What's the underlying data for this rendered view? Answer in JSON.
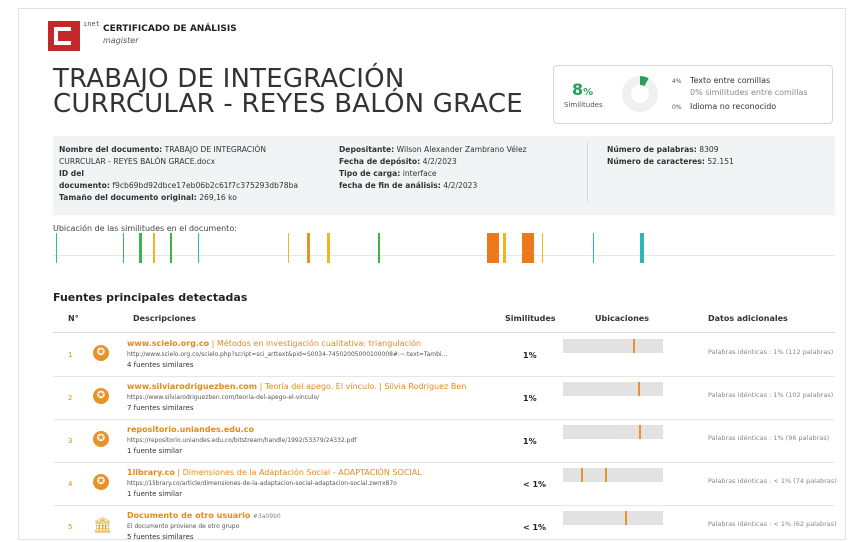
{
  "header": {
    "logo_side_text": "ınet",
    "certificate_title": "CERTIFICADO DE ANÁLISIS",
    "certificate_subtitle": "magister"
  },
  "document_title_line1": "TRABAJO DE INTEGRACIÓN",
  "document_title_line2": "CURRCULAR - REYES BALÓN GRACE",
  "similarity": {
    "percent": "8",
    "percent_sign": "%",
    "label": "Similitudes",
    "lines": [
      {
        "pct": "4%",
        "text": "Texto entre comillas",
        "muted": false
      },
      {
        "pct": "",
        "text": "0% similitudes entre comillas",
        "muted": true
      },
      {
        "pct": "0%",
        "text": "Idioma no reconocido",
        "muted": false
      }
    ]
  },
  "meta": {
    "col1": {
      "name_label": "Nombre del documento:",
      "name_value": "TRABAJO DE INTEGRACIÓN",
      "name_value2": "CURRCULAR - REYES BALÓN GRACE.docx",
      "id_label": "ID del",
      "id_label2": "documento:",
      "id_value": "f9cb69bd92dbce17eb06b2c61f7c375293db78ba",
      "size_label": "Tamaño del documento original:",
      "size_value": "269,16 ko"
    },
    "col2": {
      "depositor_label": "Depositante:",
      "depositor_value": "Wilson Alexander Zambrano Vélez",
      "deposit_date_label": "Fecha de depósito:",
      "deposit_date_value": "4/2/2023",
      "load_type_label": "Tipo de carga:",
      "load_type_value": "interface",
      "end_date_label": "fecha de fin de análisis:",
      "end_date_value": "4/2/2023"
    },
    "col3": {
      "words_label": "Número de palabras:",
      "words_value": "8309",
      "chars_label": "Número de caracteres:",
      "chars_value": "52.151"
    }
  },
  "location_label": "Ubicación de las similitudes en el documento:",
  "location_marks": [
    {
      "pos": 0.004,
      "color": "#2bb7b3",
      "width": 1
    },
    {
      "pos": 0.09,
      "color": "#3ab54a",
      "width": 1
    },
    {
      "pos": 0.11,
      "color": "#3ab54a",
      "width": 3
    },
    {
      "pos": 0.128,
      "color": "#f2b51e",
      "width": 2
    },
    {
      "pos": 0.15,
      "color": "#3ab54a",
      "width": 2
    },
    {
      "pos": 0.185,
      "color": "#2bb7b3",
      "width": 1
    },
    {
      "pos": 0.3,
      "color": "#f2b51e",
      "width": 1
    },
    {
      "pos": 0.325,
      "color": "#e8922a",
      "width": 3
    },
    {
      "pos": 0.35,
      "color": "#f2b51e",
      "width": 3
    },
    {
      "pos": 0.415,
      "color": "#3ab54a",
      "width": 2
    },
    {
      "pos": 0.555,
      "color": "#ec7a1c",
      "width": 12
    },
    {
      "pos": 0.575,
      "color": "#f2b51e",
      "width": 3
    },
    {
      "pos": 0.6,
      "color": "#ec7a1c",
      "width": 12
    },
    {
      "pos": 0.625,
      "color": "#f2b51e",
      "width": 1
    },
    {
      "pos": 0.69,
      "color": "#2bb7b3",
      "width": 1
    },
    {
      "pos": 0.75,
      "color": "#2bb7b3",
      "width": 4
    }
  ],
  "sources_section_title": "Fuentes principales detectadas",
  "table": {
    "headers": {
      "num": "N°",
      "desc": "Descripciones",
      "sim": "Similitudes",
      "loc": "Ubicaciones",
      "data": "Datos adicionales"
    },
    "rows": [
      {
        "num": "1",
        "icon": "globe-icon",
        "site": "www.scielo.org.co",
        "title": "Métodos en investigación cualitativa: triangulación",
        "url": "http://www.scielo.org.co/scielo.php?script=sci_arttext&pid=S0034-74502005000100008#:~:text=Tambi...",
        "similar": "4 fuentes similares",
        "pct": "1%",
        "marks": [
          0.7
        ],
        "extra": "Palabras idénticas : 1% (112 palabras)"
      },
      {
        "num": "2",
        "icon": "globe-icon",
        "site": "www.silviarodriguezben.com",
        "title": "Teoría del apego. El vínculo. | Silvia Rodriguez Ben",
        "url": "https://www.silviarodriguezben.com/teoria-del-apego-el-vinculo/",
        "similar": "7 fuentes similares",
        "pct": "1%",
        "marks": [
          0.75
        ],
        "extra": "Palabras idénticas : 1% (102 palabras)"
      },
      {
        "num": "3",
        "icon": "globe-icon",
        "site": "repositorio.uniandes.edu.co",
        "title": "",
        "url": "https://repositorio.uniandes.edu.co/bitstream/handle/1992/53379/24332.pdf",
        "similar": "1 fuente similar",
        "pct": "1%",
        "marks": [
          0.76
        ],
        "extra": "Palabras idénticas : 1% (96 palabras)"
      },
      {
        "num": "4",
        "icon": "globe-icon",
        "site": "1library.co",
        "title": "Dimensiones de la Adaptación Social - ADAPTACIÓN SOCIAL",
        "url": "https://1library.co/article/dimensiones-de-la-adaptacion-social-adaptacion-social.zwrrx87o",
        "similar": "1 fuente similar",
        "pct": "< 1%",
        "marks": [
          0.18,
          0.42
        ],
        "extra": "Palabras idénticas : < 1% (74 palabras)"
      },
      {
        "num": "5",
        "icon": "institution-icon",
        "site": "Documento de otro usuario",
        "tag": "#3a09b0",
        "title": "",
        "url": "El documento proviene de otro grupo",
        "similar": "5 fuentes similares",
        "pct": "< 1%",
        "marks": [
          0.62
        ],
        "extra": "Palabras idénticas : < 1% (62 palabras)"
      }
    ]
  }
}
